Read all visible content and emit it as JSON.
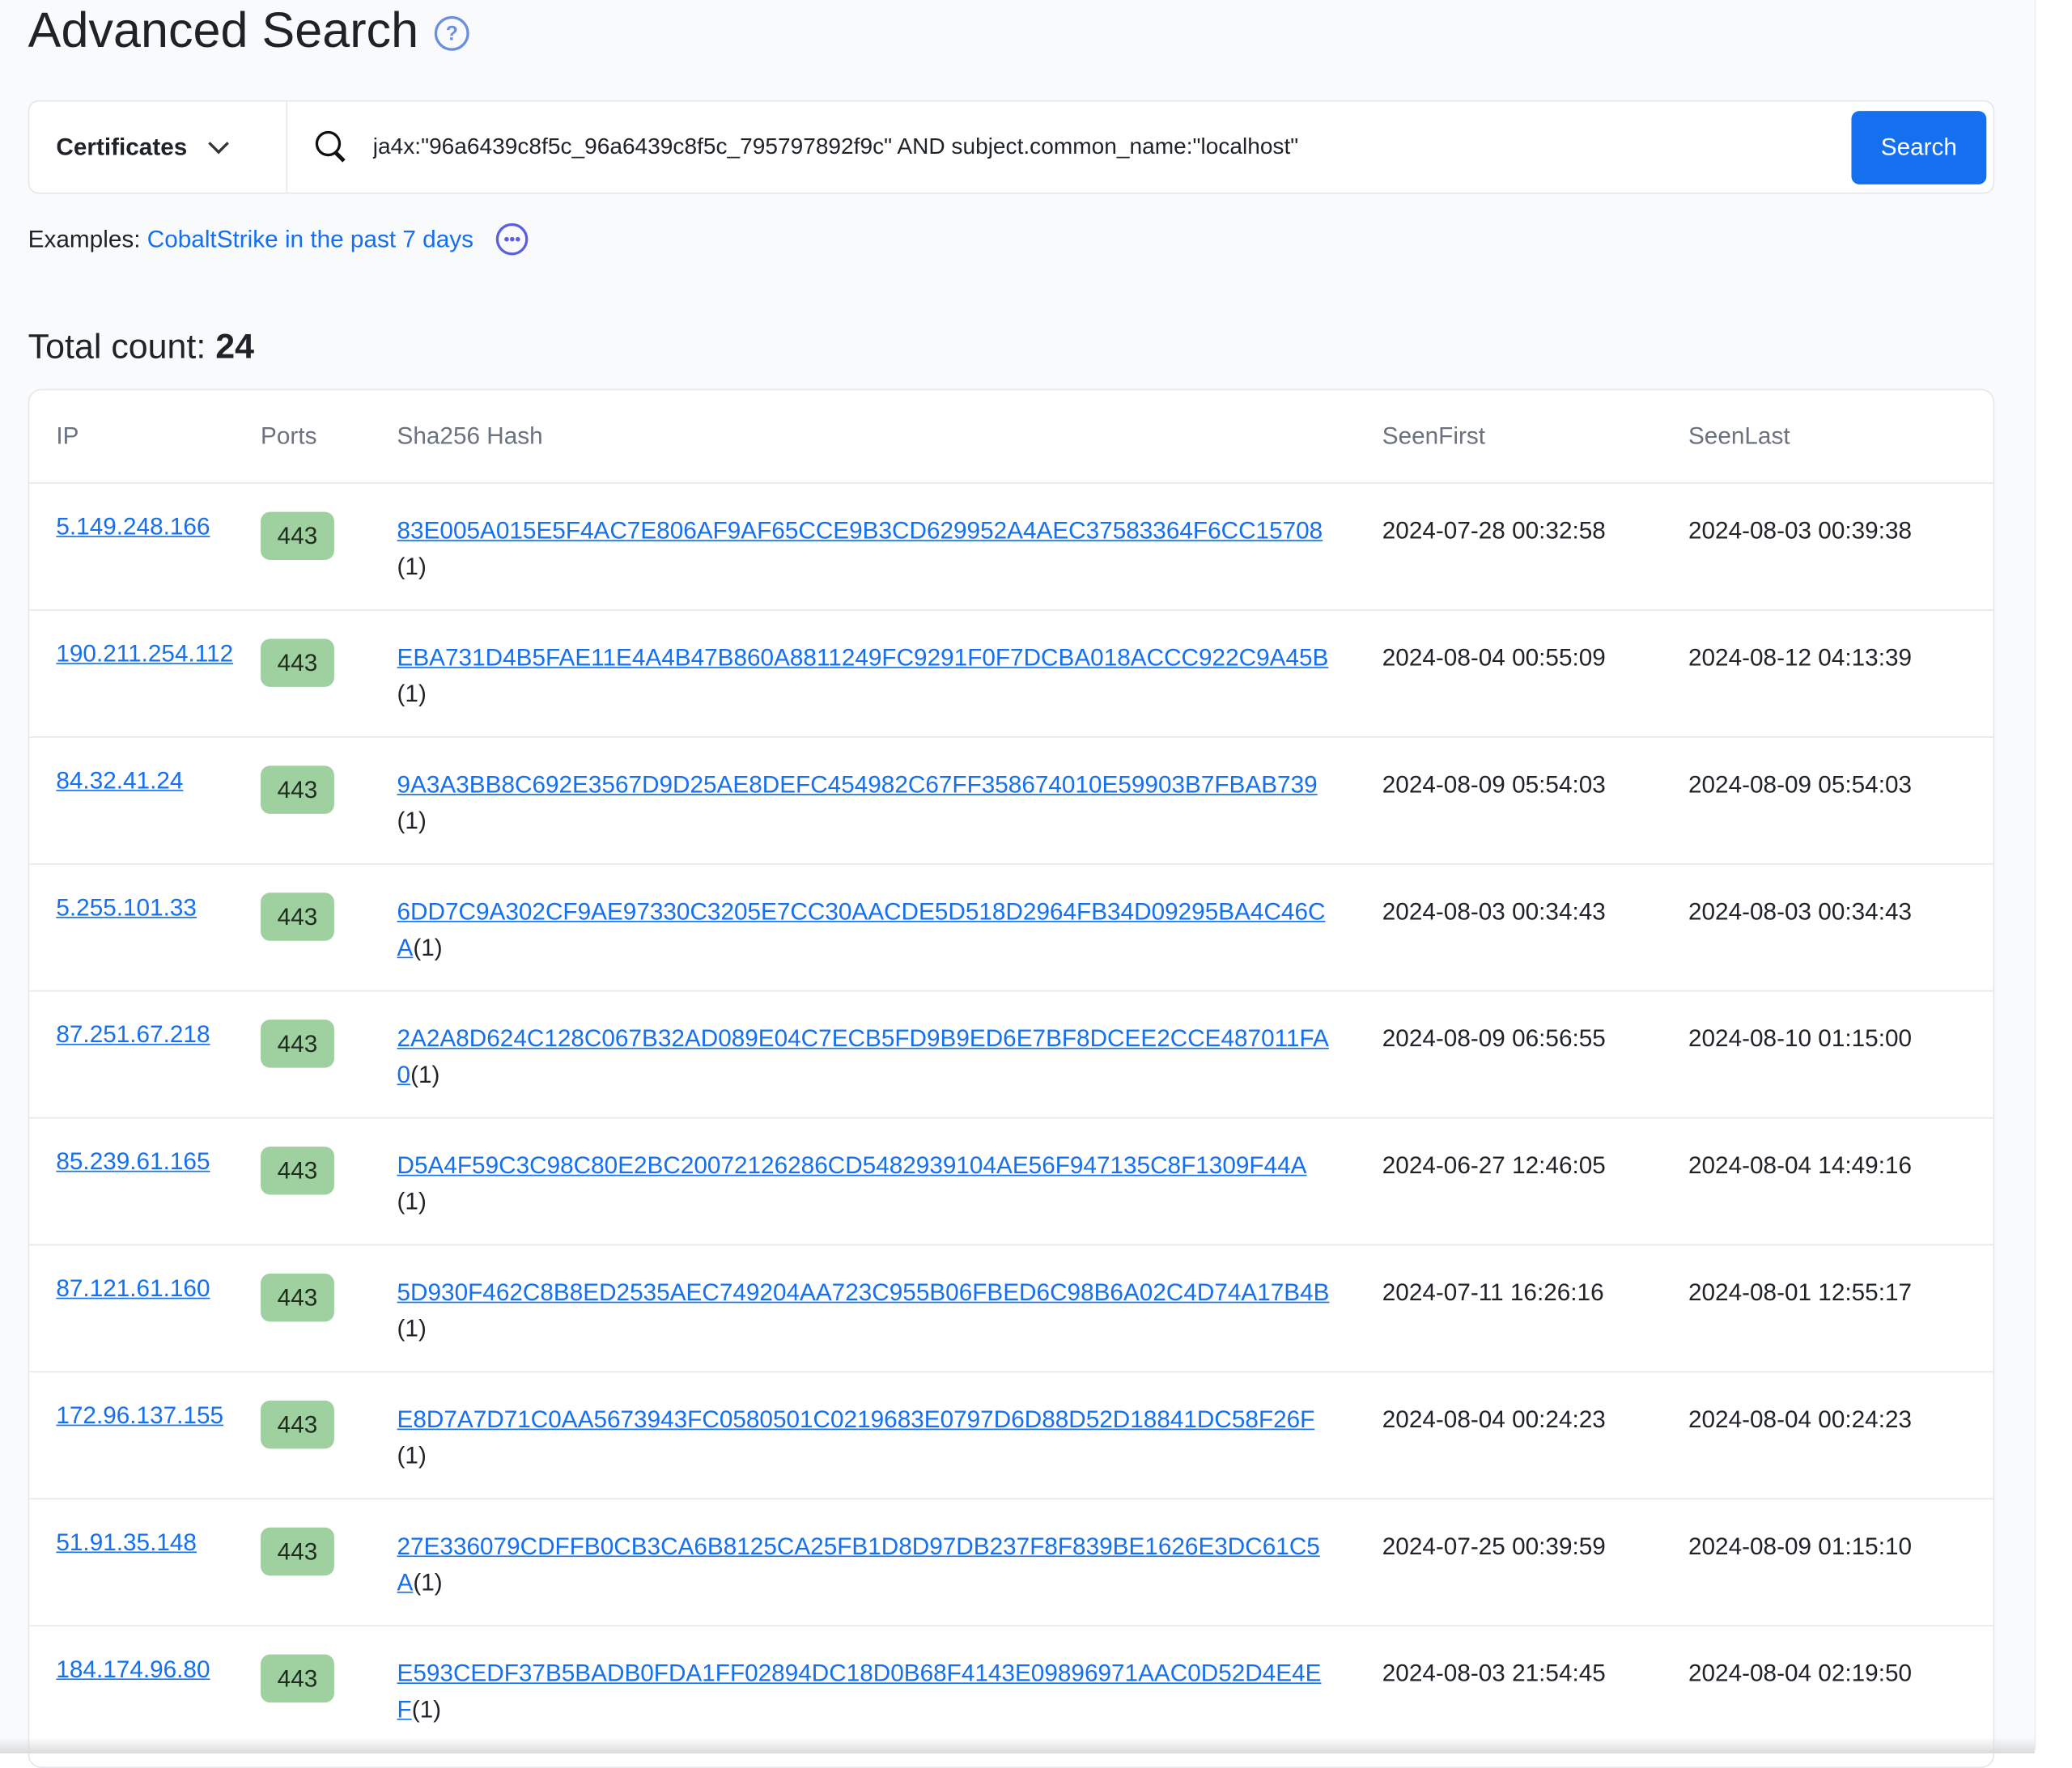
{
  "header": {
    "title": "Advanced Search",
    "help_icon": "question-circle-icon"
  },
  "search": {
    "category": "Certificates",
    "query": "ja4x:\"96a6439c8f5c_96a6439c8f5c_795797892f9c\" AND subject.common_name:\"localhost\"",
    "button_label": "Search"
  },
  "examples": {
    "label": "Examples:",
    "link": "CobaltStrike in the past 7 days",
    "more_icon": "ellipsis-circle-icon"
  },
  "results": {
    "total_label": "Total count:",
    "total": "24"
  },
  "table": {
    "columns": [
      "IP",
      "Ports",
      "Sha256 Hash",
      "SeenFirst",
      "SeenLast"
    ],
    "rows": [
      {
        "ip": "5.149.248.166",
        "port": "443",
        "hash": "83E005A015E5F4AC7E806AF9AF65CCE9B3CD629952A4AEC37583364F6CC15708",
        "count": "(1)",
        "first": "2024-07-28 00:32:58",
        "last": "2024-08-03 00:39:38"
      },
      {
        "ip": "190.211.254.112",
        "port": "443",
        "hash": "EBA731D4B5FAE11E4A4B47B860A8811249FC9291F0F7DCBA018ACCC922C9A45B",
        "count": "(1)",
        "first": "2024-08-04 00:55:09",
        "last": "2024-08-12 04:13:39"
      },
      {
        "ip": "84.32.41.24",
        "port": "443",
        "hash": "9A3A3BB8C692E3567D9D25AE8DEFC454982C67FF358674010E59903B7FBAB739",
        "count": "(1)",
        "first": "2024-08-09 05:54:03",
        "last": "2024-08-09 05:54:03"
      },
      {
        "ip": "5.255.101.33",
        "port": "443",
        "hash": "6DD7C9A302CF9AE97330C3205E7CC30AACDE5D518D2964FB34D09295BA4C46CA",
        "count": "(1)",
        "first": "2024-08-03 00:34:43",
        "last": "2024-08-03 00:34:43"
      },
      {
        "ip": "87.251.67.218",
        "port": "443",
        "hash": "2A2A8D624C128C067B32AD089E04C7ECB5FD9B9ED6E7BF8DCEE2CCE487011FA0",
        "count": "(1)",
        "first": "2024-08-09 06:56:55",
        "last": "2024-08-10 01:15:00"
      },
      {
        "ip": "85.239.61.165",
        "port": "443",
        "hash": "D5A4F59C3C98C80E2BC20072126286CD5482939104AE56F947135C8F1309F44A",
        "count": "(1)",
        "first": "2024-06-27 12:46:05",
        "last": "2024-08-04 14:49:16"
      },
      {
        "ip": "87.121.61.160",
        "port": "443",
        "hash": "5D930F462C8B8ED2535AEC749204AA723C955B06FBED6C98B6A02C4D74A17B4B",
        "count": "(1)",
        "first": "2024-07-11 16:26:16",
        "last": "2024-08-01 12:55:17"
      },
      {
        "ip": "172.96.137.155",
        "port": "443",
        "hash": "E8D7A7D71C0AA5673943FC0580501C0219683E0797D6D88D52D18841DC58F26F",
        "count": "(1)",
        "first": "2024-08-04 00:24:23",
        "last": "2024-08-04 00:24:23"
      },
      {
        "ip": "51.91.35.148",
        "port": "443",
        "hash": "27E336079CDFFB0CB3CA6B8125CA25FB1D8D97DB237F8F839BE1626E3DC61C5A",
        "count": "(1)",
        "first": "2024-07-25 00:39:59",
        "last": "2024-08-09 01:15:10"
      },
      {
        "ip": "184.174.96.80",
        "port": "443",
        "hash": "E593CEDF37B5BADB0FDA1FF02894DC18D0B68F4143E09896971AAC0D52D4E4EF",
        "count": "(1)",
        "first": "2024-08-03 21:54:45",
        "last": "2024-08-04 02:19:50"
      }
    ]
  },
  "colors": {
    "accent": "#1570ef",
    "port_badge": "#9fd0a0",
    "background": "#f9fafb"
  }
}
